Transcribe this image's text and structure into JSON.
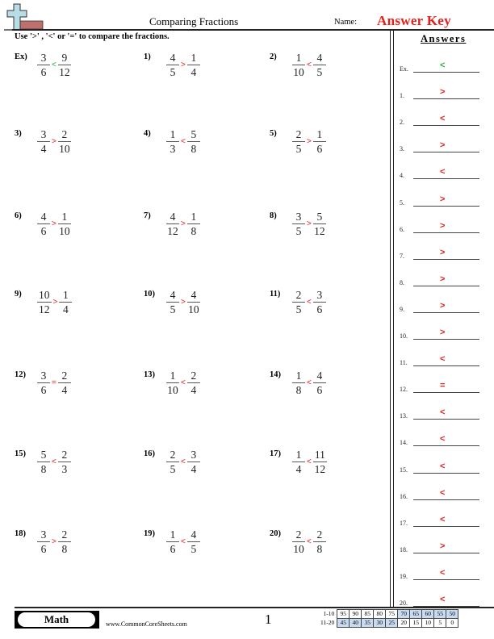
{
  "header": {
    "title": "Comparing Fractions",
    "name_label": "Name:",
    "name_value": "Answer Key",
    "instructions": "Use '>' , '<' or '=' to compare the fractions."
  },
  "colors": {
    "example_symbol": "#22b14c",
    "answer_symbol": "#e8201b",
    "score_highlight": "#c9dbf2"
  },
  "problems": [
    {
      "label": "Ex)",
      "left": {
        "n": "3",
        "d": "6"
      },
      "symbol": "<",
      "right": {
        "n": "9",
        "d": "12"
      },
      "example": true
    },
    {
      "label": "1)",
      "left": {
        "n": "4",
        "d": "5"
      },
      "symbol": ">",
      "right": {
        "n": "1",
        "d": "4"
      }
    },
    {
      "label": "2)",
      "left": {
        "n": "1",
        "d": "10"
      },
      "symbol": "<",
      "right": {
        "n": "4",
        "d": "5"
      }
    },
    {
      "label": "3)",
      "left": {
        "n": "3",
        "d": "4"
      },
      "symbol": ">",
      "right": {
        "n": "2",
        "d": "10"
      }
    },
    {
      "label": "4)",
      "left": {
        "n": "1",
        "d": "3"
      },
      "symbol": "<",
      "right": {
        "n": "5",
        "d": "8"
      }
    },
    {
      "label": "5)",
      "left": {
        "n": "2",
        "d": "5"
      },
      "symbol": ">",
      "right": {
        "n": "1",
        "d": "6"
      }
    },
    {
      "label": "6)",
      "left": {
        "n": "4",
        "d": "6"
      },
      "symbol": ">",
      "right": {
        "n": "1",
        "d": "10"
      }
    },
    {
      "label": "7)",
      "left": {
        "n": "4",
        "d": "12"
      },
      "symbol": ">",
      "right": {
        "n": "1",
        "d": "8"
      }
    },
    {
      "label": "8)",
      "left": {
        "n": "3",
        "d": "5"
      },
      "symbol": ">",
      "right": {
        "n": "5",
        "d": "12"
      }
    },
    {
      "label": "9)",
      "left": {
        "n": "10",
        "d": "12"
      },
      "symbol": ">",
      "right": {
        "n": "1",
        "d": "4"
      }
    },
    {
      "label": "10)",
      "left": {
        "n": "4",
        "d": "5"
      },
      "symbol": ">",
      "right": {
        "n": "4",
        "d": "10"
      }
    },
    {
      "label": "11)",
      "left": {
        "n": "2",
        "d": "5"
      },
      "symbol": "<",
      "right": {
        "n": "3",
        "d": "6"
      }
    },
    {
      "label": "12)",
      "left": {
        "n": "3",
        "d": "6"
      },
      "symbol": "=",
      "right": {
        "n": "2",
        "d": "4"
      }
    },
    {
      "label": "13)",
      "left": {
        "n": "1",
        "d": "10"
      },
      "symbol": "<",
      "right": {
        "n": "2",
        "d": "4"
      }
    },
    {
      "label": "14)",
      "left": {
        "n": "1",
        "d": "8"
      },
      "symbol": "<",
      "right": {
        "n": "4",
        "d": "6"
      }
    },
    {
      "label": "15)",
      "left": {
        "n": "5",
        "d": "8"
      },
      "symbol": "<",
      "right": {
        "n": "2",
        "d": "3"
      }
    },
    {
      "label": "16)",
      "left": {
        "n": "2",
        "d": "5"
      },
      "symbol": "<",
      "right": {
        "n": "3",
        "d": "4"
      }
    },
    {
      "label": "17)",
      "left": {
        "n": "1",
        "d": "4"
      },
      "symbol": "<",
      "right": {
        "n": "11",
        "d": "12"
      }
    },
    {
      "label": "18)",
      "left": {
        "n": "3",
        "d": "6"
      },
      "symbol": ">",
      "right": {
        "n": "2",
        "d": "8"
      }
    },
    {
      "label": "19)",
      "left": {
        "n": "1",
        "d": "6"
      },
      "symbol": "<",
      "right": {
        "n": "4",
        "d": "5"
      }
    },
    {
      "label": "20)",
      "left": {
        "n": "2",
        "d": "10"
      },
      "symbol": "<",
      "right": {
        "n": "2",
        "d": "8"
      }
    }
  ],
  "answers": {
    "title": "Answers",
    "items": [
      {
        "label": "Ex.",
        "value": "<",
        "example": true
      },
      {
        "label": "1.",
        "value": ">"
      },
      {
        "label": "2.",
        "value": "<"
      },
      {
        "label": "3.",
        "value": ">"
      },
      {
        "label": "4.",
        "value": "<"
      },
      {
        "label": "5.",
        "value": ">"
      },
      {
        "label": "6.",
        "value": ">"
      },
      {
        "label": "7.",
        "value": ">"
      },
      {
        "label": "8.",
        "value": ">"
      },
      {
        "label": "9.",
        "value": ">"
      },
      {
        "label": "10.",
        "value": ">"
      },
      {
        "label": "11.",
        "value": "<"
      },
      {
        "label": "12.",
        "value": "="
      },
      {
        "label": "13.",
        "value": "<"
      },
      {
        "label": "14.",
        "value": "<"
      },
      {
        "label": "15.",
        "value": "<"
      },
      {
        "label": "16.",
        "value": "<"
      },
      {
        "label": "17.",
        "value": "<"
      },
      {
        "label": "18.",
        "value": ">"
      },
      {
        "label": "19.",
        "value": "<"
      },
      {
        "label": "20.",
        "value": "<"
      }
    ]
  },
  "footer": {
    "subject": "Math",
    "site": "www.CommonCoreSheets.com",
    "page": "1",
    "score_rows": [
      {
        "label": "1-10",
        "scores": [
          "95",
          "90",
          "85",
          "80",
          "75",
          "70",
          "65",
          "60",
          "55",
          "50"
        ],
        "highlight": [
          false,
          false,
          false,
          false,
          false,
          true,
          true,
          true,
          true,
          true
        ]
      },
      {
        "label": "11-20",
        "scores": [
          "45",
          "40",
          "35",
          "30",
          "25",
          "20",
          "15",
          "10",
          "5",
          "0"
        ],
        "highlight": [
          true,
          true,
          true,
          true,
          true,
          false,
          false,
          false,
          false,
          false
        ]
      }
    ]
  }
}
